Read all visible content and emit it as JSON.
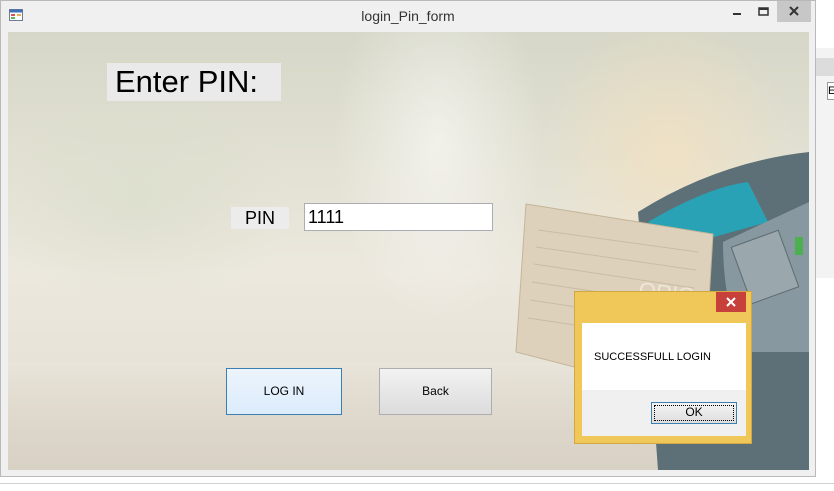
{
  "background_window": {
    "field_text": "E"
  },
  "window": {
    "title": "login_Pin_form",
    "icons": {
      "app": "form-icon",
      "minimize": "minimize-icon",
      "maximize": "maximize-icon",
      "close": "close-icon"
    }
  },
  "form": {
    "heading": "Enter PIN:",
    "pin_label": "PIN",
    "pin_value": "1111",
    "login_button": "LOG IN",
    "back_button": "Back"
  },
  "messagebox": {
    "message": "SUCCESSFULL LOGIN",
    "ok_button": "OK",
    "close_icon": "close-icon"
  },
  "colors": {
    "messagebox_frame": "#f0c85a",
    "messagebox_close": "#c7403a",
    "focus_border": "#3c7fb1"
  }
}
